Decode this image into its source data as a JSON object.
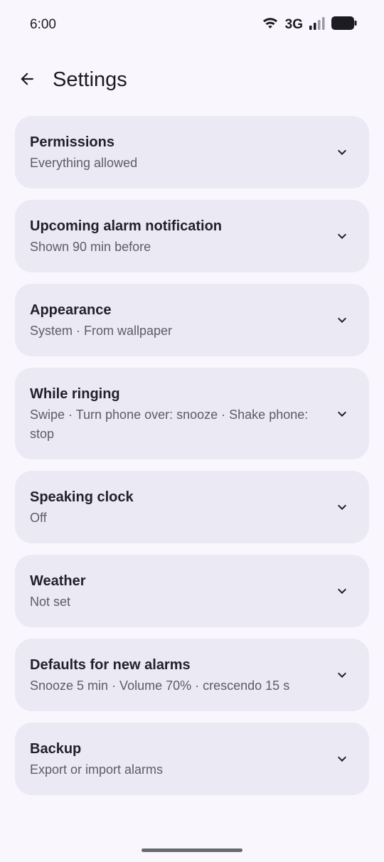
{
  "status_bar": {
    "time": "6:00",
    "network_type": "3G",
    "icons": [
      "wifi-icon",
      "signal-icon",
      "battery-icon"
    ]
  },
  "header": {
    "title": "Settings",
    "back_icon": "arrow-back-icon"
  },
  "settings": [
    {
      "id": "permissions",
      "title": "Permissions",
      "subtitle": "Everything allowed"
    },
    {
      "id": "upcoming-alarm-notification",
      "title": "Upcoming alarm notification",
      "subtitle": "Shown 90 min before"
    },
    {
      "id": "appearance",
      "title": "Appearance",
      "subtitle": "System · From wallpaper"
    },
    {
      "id": "while-ringing",
      "title": "While ringing",
      "subtitle": "Swipe · Turn phone over: snooze · Shake phone: stop"
    },
    {
      "id": "speaking-clock",
      "title": "Speaking clock",
      "subtitle": "Off"
    },
    {
      "id": "weather",
      "title": "Weather",
      "subtitle": "Not set"
    },
    {
      "id": "defaults-for-new-alarms",
      "title": "Defaults for new alarms",
      "subtitle": "Snooze 5 min · Volume 70% · crescendo 15 s"
    },
    {
      "id": "backup",
      "title": "Backup",
      "subtitle": "Export or import alarms"
    }
  ],
  "colors": {
    "background": "#f9f6fd",
    "card": "#ebe9f4",
    "title_text": "#22212b",
    "subtitle_text": "#5e5c69"
  }
}
